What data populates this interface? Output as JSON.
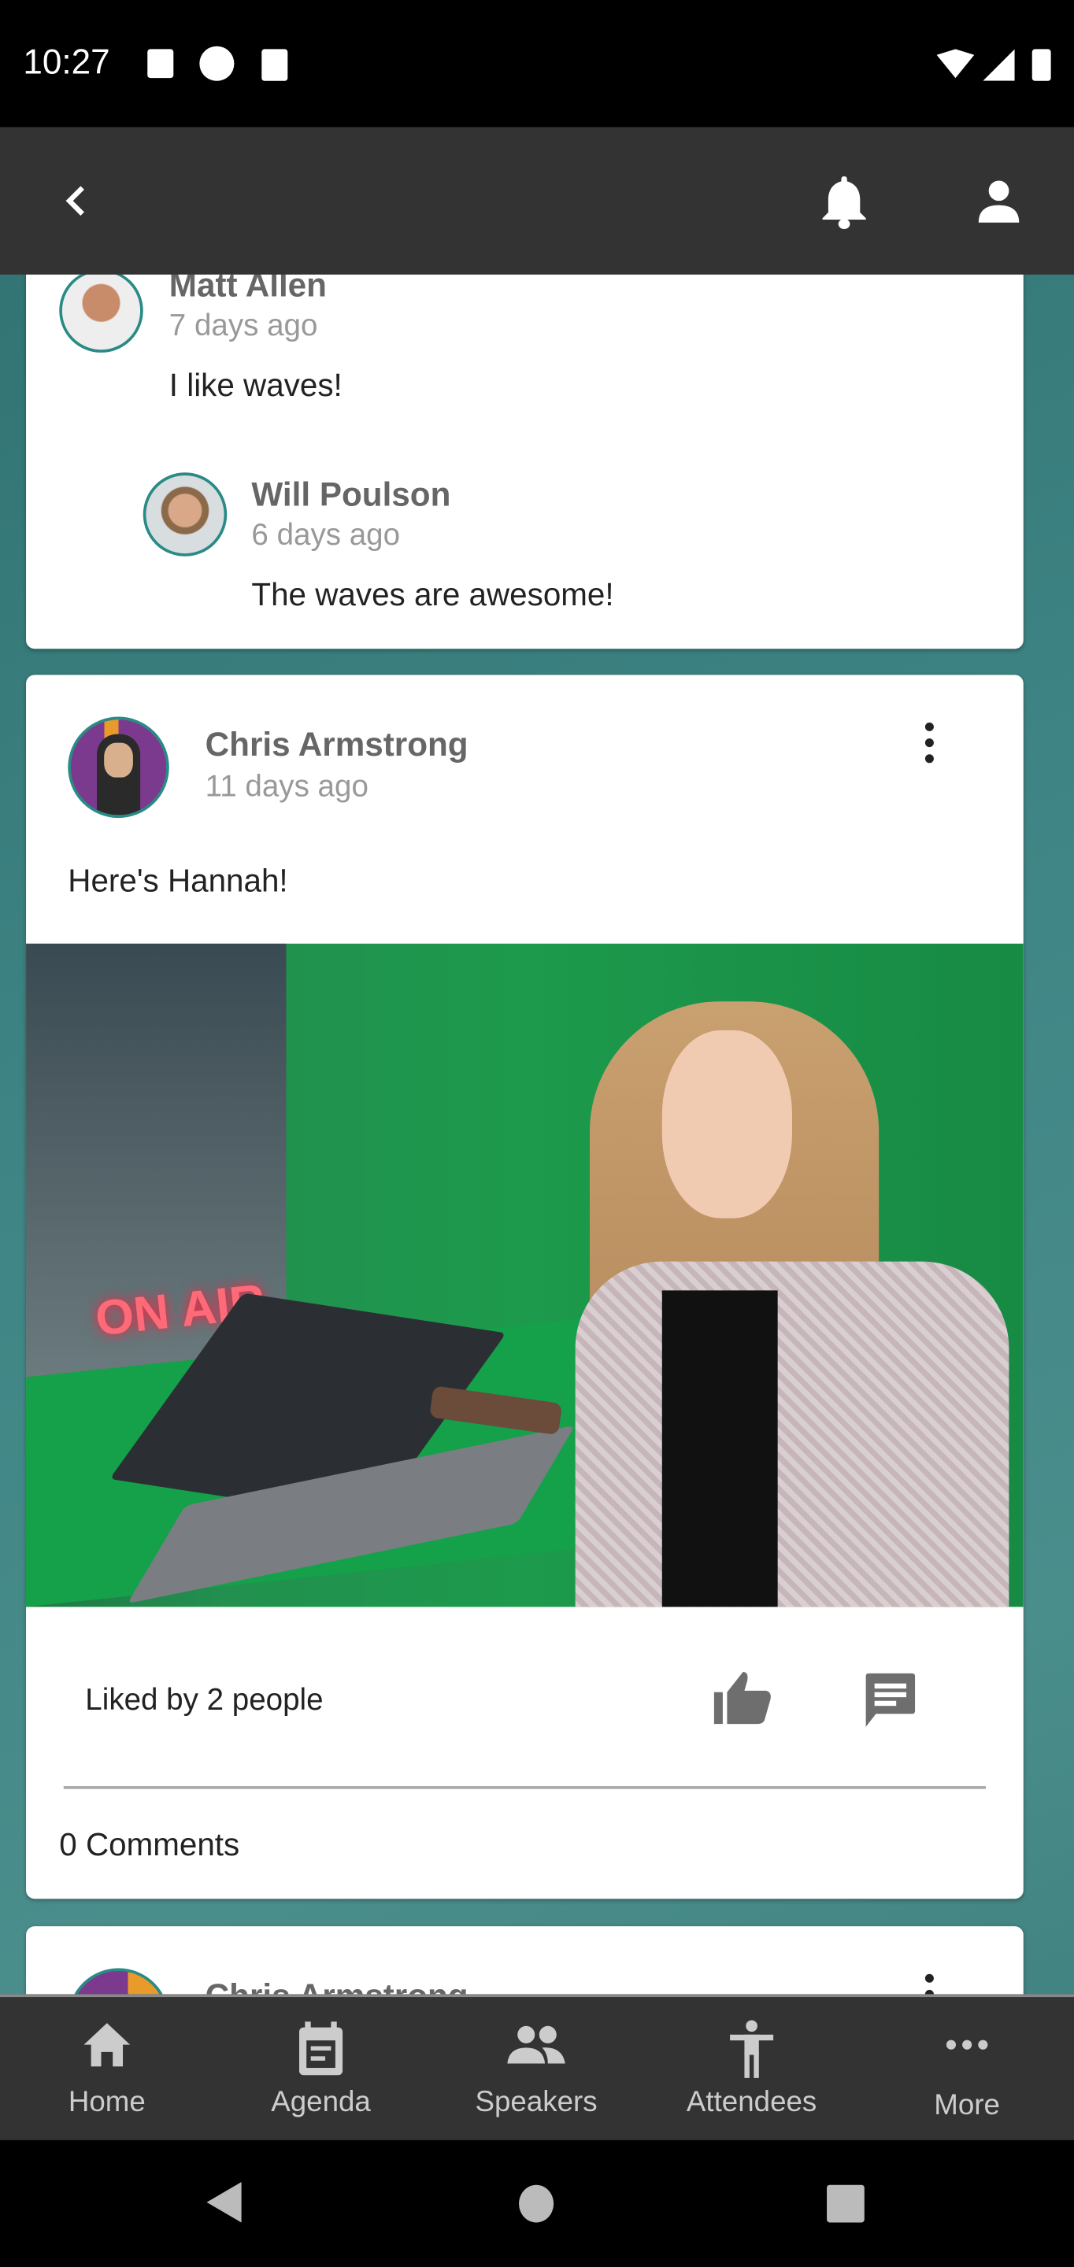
{
  "status_bar": {
    "time": "10:27"
  },
  "app_bar": {
    "back_icon": "chevron-left-icon",
    "notifications_icon": "bell-icon",
    "profile_icon": "person-icon"
  },
  "posts": [
    {
      "comments": [
        {
          "author": "Matt Allen",
          "time": "7 days ago",
          "text": "I like waves!"
        },
        {
          "author": "Will Poulson",
          "time": "6 days ago",
          "text": "The waves are awesome!"
        }
      ]
    },
    {
      "author": "Chris Armstrong",
      "time": "11 days ago",
      "text": "Here's Hannah!",
      "image_sign": "ON AIR",
      "likes": "Liked by 2 people",
      "comments_count": "0 Comments"
    },
    {
      "author": "Chris Armstrong"
    }
  ],
  "bottom_nav": [
    {
      "label": "Home",
      "icon": "home-icon"
    },
    {
      "label": "Agenda",
      "icon": "calendar-icon"
    },
    {
      "label": "Speakers",
      "icon": "people-icon"
    },
    {
      "label": "Attendees",
      "icon": "person-standing-icon"
    },
    {
      "label": "More",
      "icon": "more-horizontal-icon"
    }
  ],
  "colors": {
    "app_bar": "#333333",
    "accent": "#2a8a86",
    "background": "#3f8585"
  }
}
